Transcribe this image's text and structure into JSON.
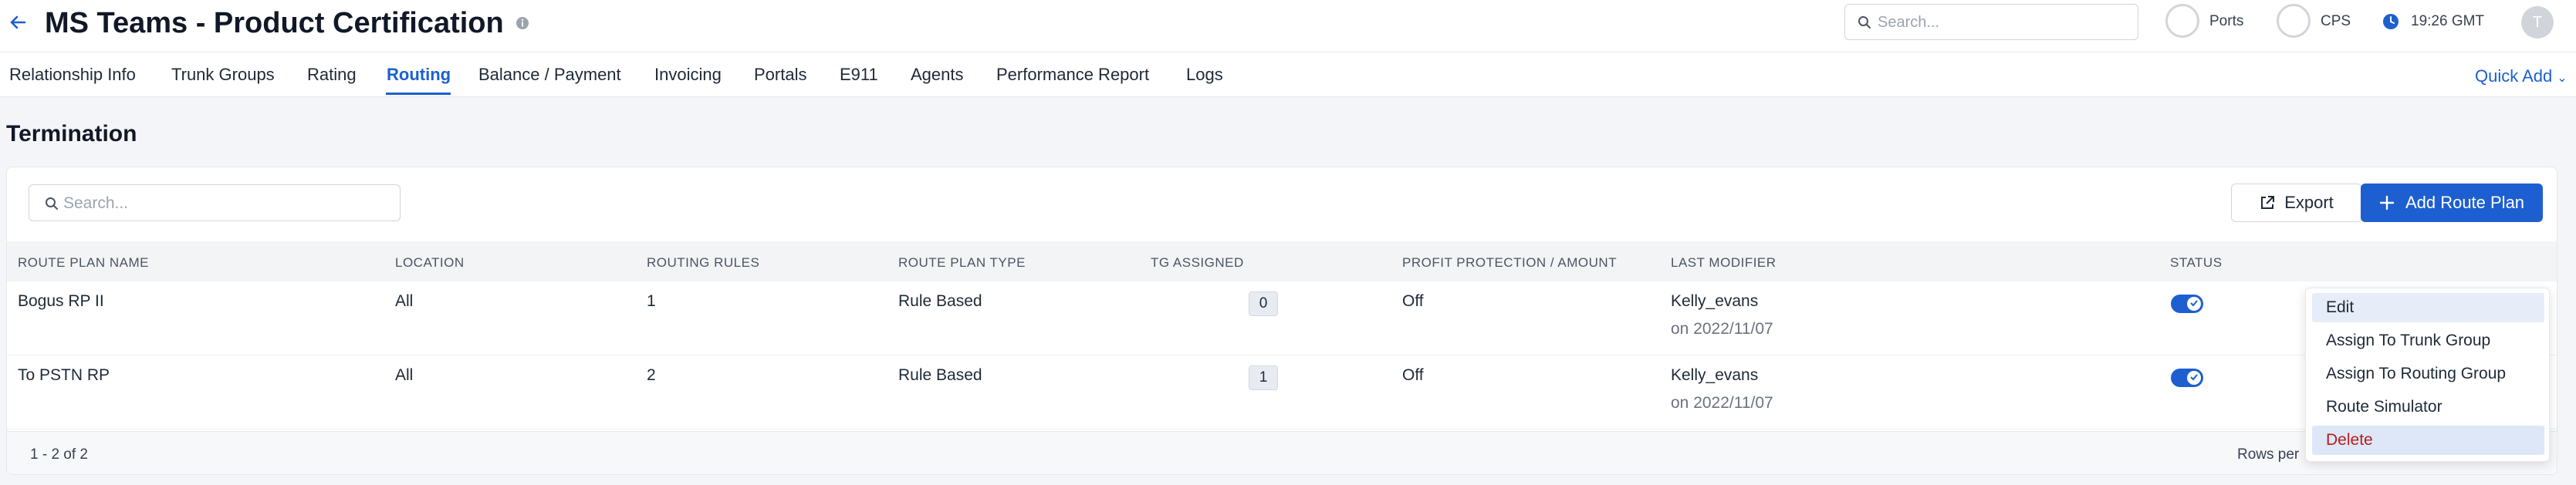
{
  "header": {
    "back_icon": "arrow-left-icon",
    "title": "MS Teams - Product Certification",
    "info_icon": "info-icon",
    "search_placeholder": "Search...",
    "ports_label": "Ports",
    "cps_label": "CPS",
    "time": "19:26 GMT",
    "avatar_initial": "T"
  },
  "tabs": [
    {
      "label": "Relationship Info",
      "active": false
    },
    {
      "label": "Trunk Groups",
      "active": false
    },
    {
      "label": "Rating",
      "active": false
    },
    {
      "label": "Routing",
      "active": true
    },
    {
      "label": "Balance / Payment",
      "active": false
    },
    {
      "label": "Invoicing",
      "active": false
    },
    {
      "label": "Portals",
      "active": false
    },
    {
      "label": "E911",
      "active": false
    },
    {
      "label": "Agents",
      "active": false
    },
    {
      "label": "Performance Report",
      "active": false
    },
    {
      "label": "Logs",
      "active": false
    }
  ],
  "quick_add": "Quick Add",
  "section_title": "Termination",
  "toolbar": {
    "search_placeholder": "Search...",
    "export_label": "Export",
    "add_label": "Add Route Plan"
  },
  "table": {
    "columns": [
      "Route Plan Name",
      "Location",
      "Routing Rules",
      "Route Plan Type",
      "TG Assigned",
      "Profit Protection / Amount",
      "Last Modifier",
      "Status"
    ],
    "rows": [
      {
        "name": "Bogus RP II",
        "location": "All",
        "rules": "1",
        "type": "Rule Based",
        "tg": "0",
        "profit": "Off",
        "modifier": "Kelly_evans",
        "modified": "on 2022/11/07",
        "status": true
      },
      {
        "name": "To PSTN RP",
        "location": "All",
        "rules": "2",
        "type": "Rule Based",
        "tg": "1",
        "profit": "Off",
        "modifier": "Kelly_evans",
        "modified": "on 2022/11/07",
        "status": true
      }
    ]
  },
  "footer": {
    "count": "1 - 2 of 2",
    "rows_per_page": "Rows per"
  },
  "menu": {
    "items": [
      "Edit",
      "Assign To Trunk Group",
      "Assign To Routing Group",
      "Route Simulator",
      "Delete"
    ]
  },
  "colors": {
    "accent": "#1d5fd0",
    "danger": "#b91c1c"
  }
}
